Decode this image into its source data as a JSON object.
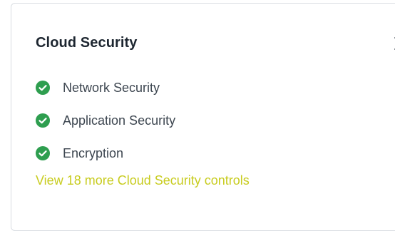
{
  "card": {
    "title": "Cloud Security",
    "chevron_icon": "chevron-right-icon",
    "controls": [
      {
        "label": "Network Security",
        "icon": "check-circle-icon",
        "status_color": "#2e9e4f"
      },
      {
        "label": "Application Security",
        "icon": "check-circle-icon",
        "status_color": "#2e9e4f"
      },
      {
        "label": "Encryption",
        "icon": "check-circle-icon",
        "status_color": "#2e9e4f"
      }
    ],
    "more_link": "View 18 more Cloud Security controls",
    "link_color": "#c8cc1f"
  }
}
